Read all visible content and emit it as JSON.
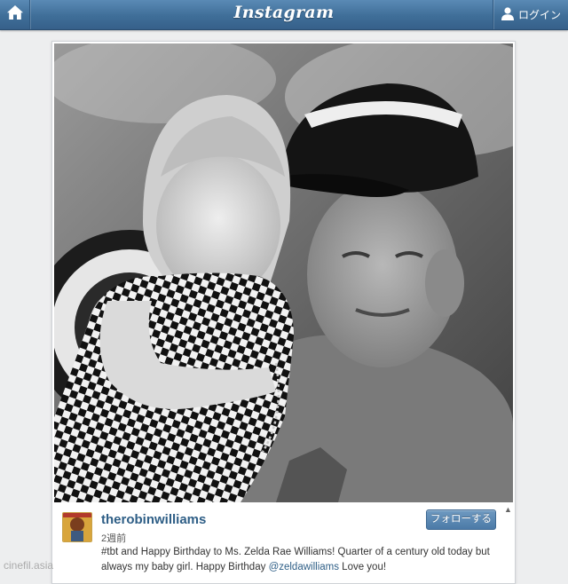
{
  "topbar": {
    "home_icon": "home-icon",
    "logo_text": "Instagram",
    "user_icon": "user-icon",
    "login_label": "ログイン"
  },
  "post": {
    "username": "therobinwilliams",
    "time_ago": "2週前",
    "follow_label": "フォローする",
    "caption_before": "#tbt and Happy Birthday to Ms. Zelda Rae Williams! Quarter of a century old today but always my baby girl. Happy Birthday ",
    "caption_mention": "@zeldawilliams",
    "caption_after": " Love you!",
    "photo_description": "photo",
    "scroll_up_icon": "scroll-up-icon"
  },
  "watermark": "cinefil.asia",
  "colors": {
    "topbar": "#3f6e98",
    "link": "#2e5e86",
    "follow_button": "#4b7aa7",
    "background": "#edeeef"
  }
}
